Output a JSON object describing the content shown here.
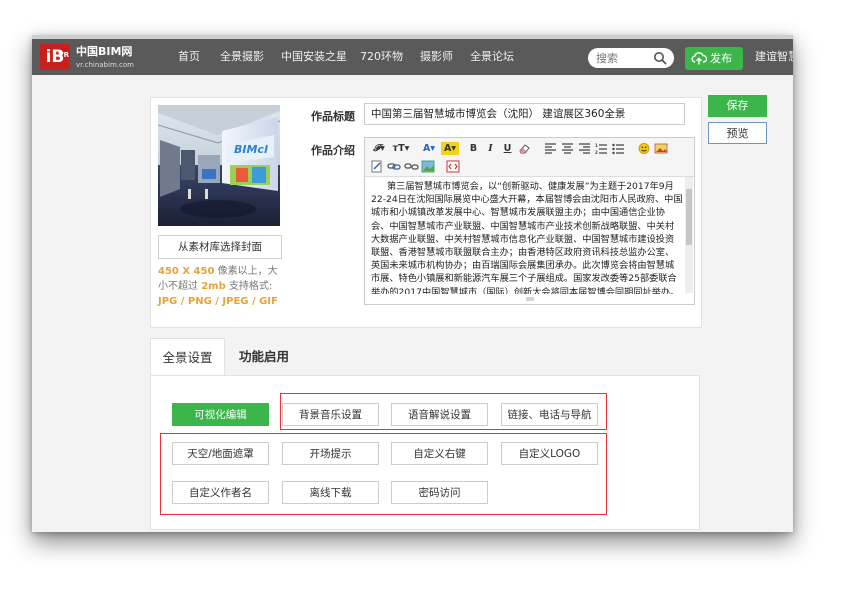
{
  "brand": {
    "logo_text": "iB",
    "logo_badge": "VR",
    "name": "中国BIM网",
    "domain": "vr.chinabim.com"
  },
  "nav": {
    "items": [
      "首页",
      "全景摄影",
      "中国安装之星",
      "720环物",
      "摄影师",
      "全景论坛"
    ],
    "search_placeholder": "搜索",
    "publish_label": "发布",
    "right_text": "建谊智慧"
  },
  "form": {
    "choose_cover_label": "从素材库选择封面",
    "hint": {
      "size": "450 X 450",
      "text1": " 像素以上，大小不超过 ",
      "limit": "2mb",
      "text2": " 支持格式: ",
      "formats": "JPG / PNG / JPEG / GIF"
    },
    "title_label": "作品标题",
    "title_value": "中国第三届智慧城市博览会（沈阳） 建谊展区360全景",
    "intro_label": "作品介绍",
    "intro_text": "第三届智慧城市博览会，以“创新驱动、健康发展”为主题于2017年9月22-24日在沈阳国际展览中心盛大开幕，本届智博会由沈阳市人民政府、中国城市和小城镇改革发展中心、智慧城市发展联盟主办；由中国通信企业协会、中国智慧城市产业联盟、中国智慧城市产业技术创新战略联盟、中关村大数据产业联盟、中关村智慧城市信息化产业联盟、中国智慧城市建设投资联盟、香港智慧城市联盟联合主办；由香港特区政府资讯科技总监办公室、英国未来城市机构协办；由百瑞国际会展集团承办。此次博览会将由智慧城市展、特色小镇展和新能源汽车展三个子展组成。国家发改委等25部委联合举办的2017中国智慧城市（国际）创新大会将同本届智博会同期同址举办。 其中北京建谊"
  },
  "actions": {
    "save_label": "保存",
    "preview_label": "预览"
  },
  "tabs": [
    {
      "label": "全景设置",
      "active": true
    },
    {
      "label": "功能启用",
      "active": false
    }
  ],
  "settings": {
    "row1": [
      "可视化编辑",
      "背景音乐设置",
      "语音解说设置",
      "链接、电话与导航"
    ],
    "row2": [
      "天空/地面遮罩",
      "开场提示",
      "自定义右键",
      "自定义LOGO"
    ],
    "row3": [
      "自定义作者名",
      "离线下载",
      "密码访问"
    ]
  },
  "colors": {
    "accent_green": "#3cb54a",
    "brand_red": "#c8201f",
    "highlight_red": "#e8323c",
    "nav_bg": "#5a5a5a"
  }
}
